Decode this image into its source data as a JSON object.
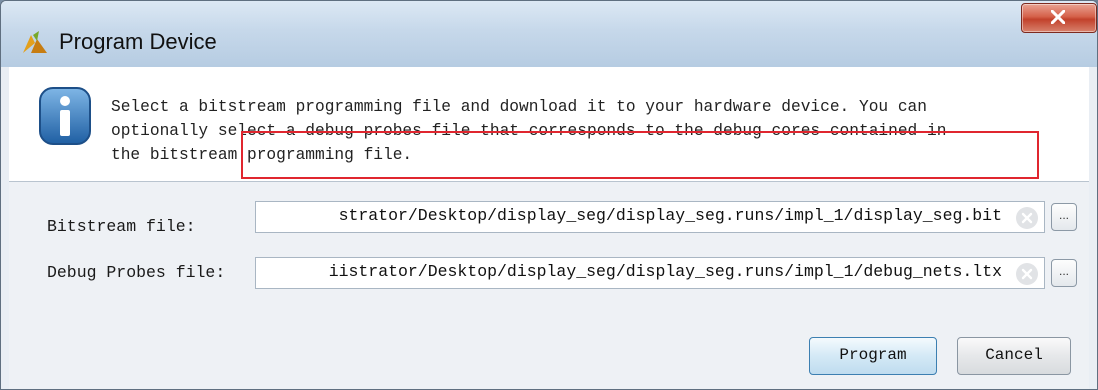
{
  "window": {
    "title": "Program Device"
  },
  "info": {
    "lines": [
      "Select a bitstream programming file and download it to your hardware device. You can",
      "optionally select a debug probes file that corresponds to the debug cores contained in",
      "the bitstream programming file."
    ]
  },
  "bitstream": {
    "label": "Bitstream file:",
    "value": "strator/Desktop/display_seg/display_seg.runs/impl_1/display_seg.bit",
    "browse_label": "..."
  },
  "probes": {
    "label": "Debug Probes file:",
    "value": "iistrator/Desktop/display_seg/display_seg.runs/impl_1/debug_nets.ltx",
    "browse_label": "..."
  },
  "buttons": {
    "program": "Program",
    "cancel": "Cancel"
  },
  "colors": {
    "highlight": "#e0262f",
    "close_button": "#c2412b",
    "info_icon": "#2f74b6"
  }
}
